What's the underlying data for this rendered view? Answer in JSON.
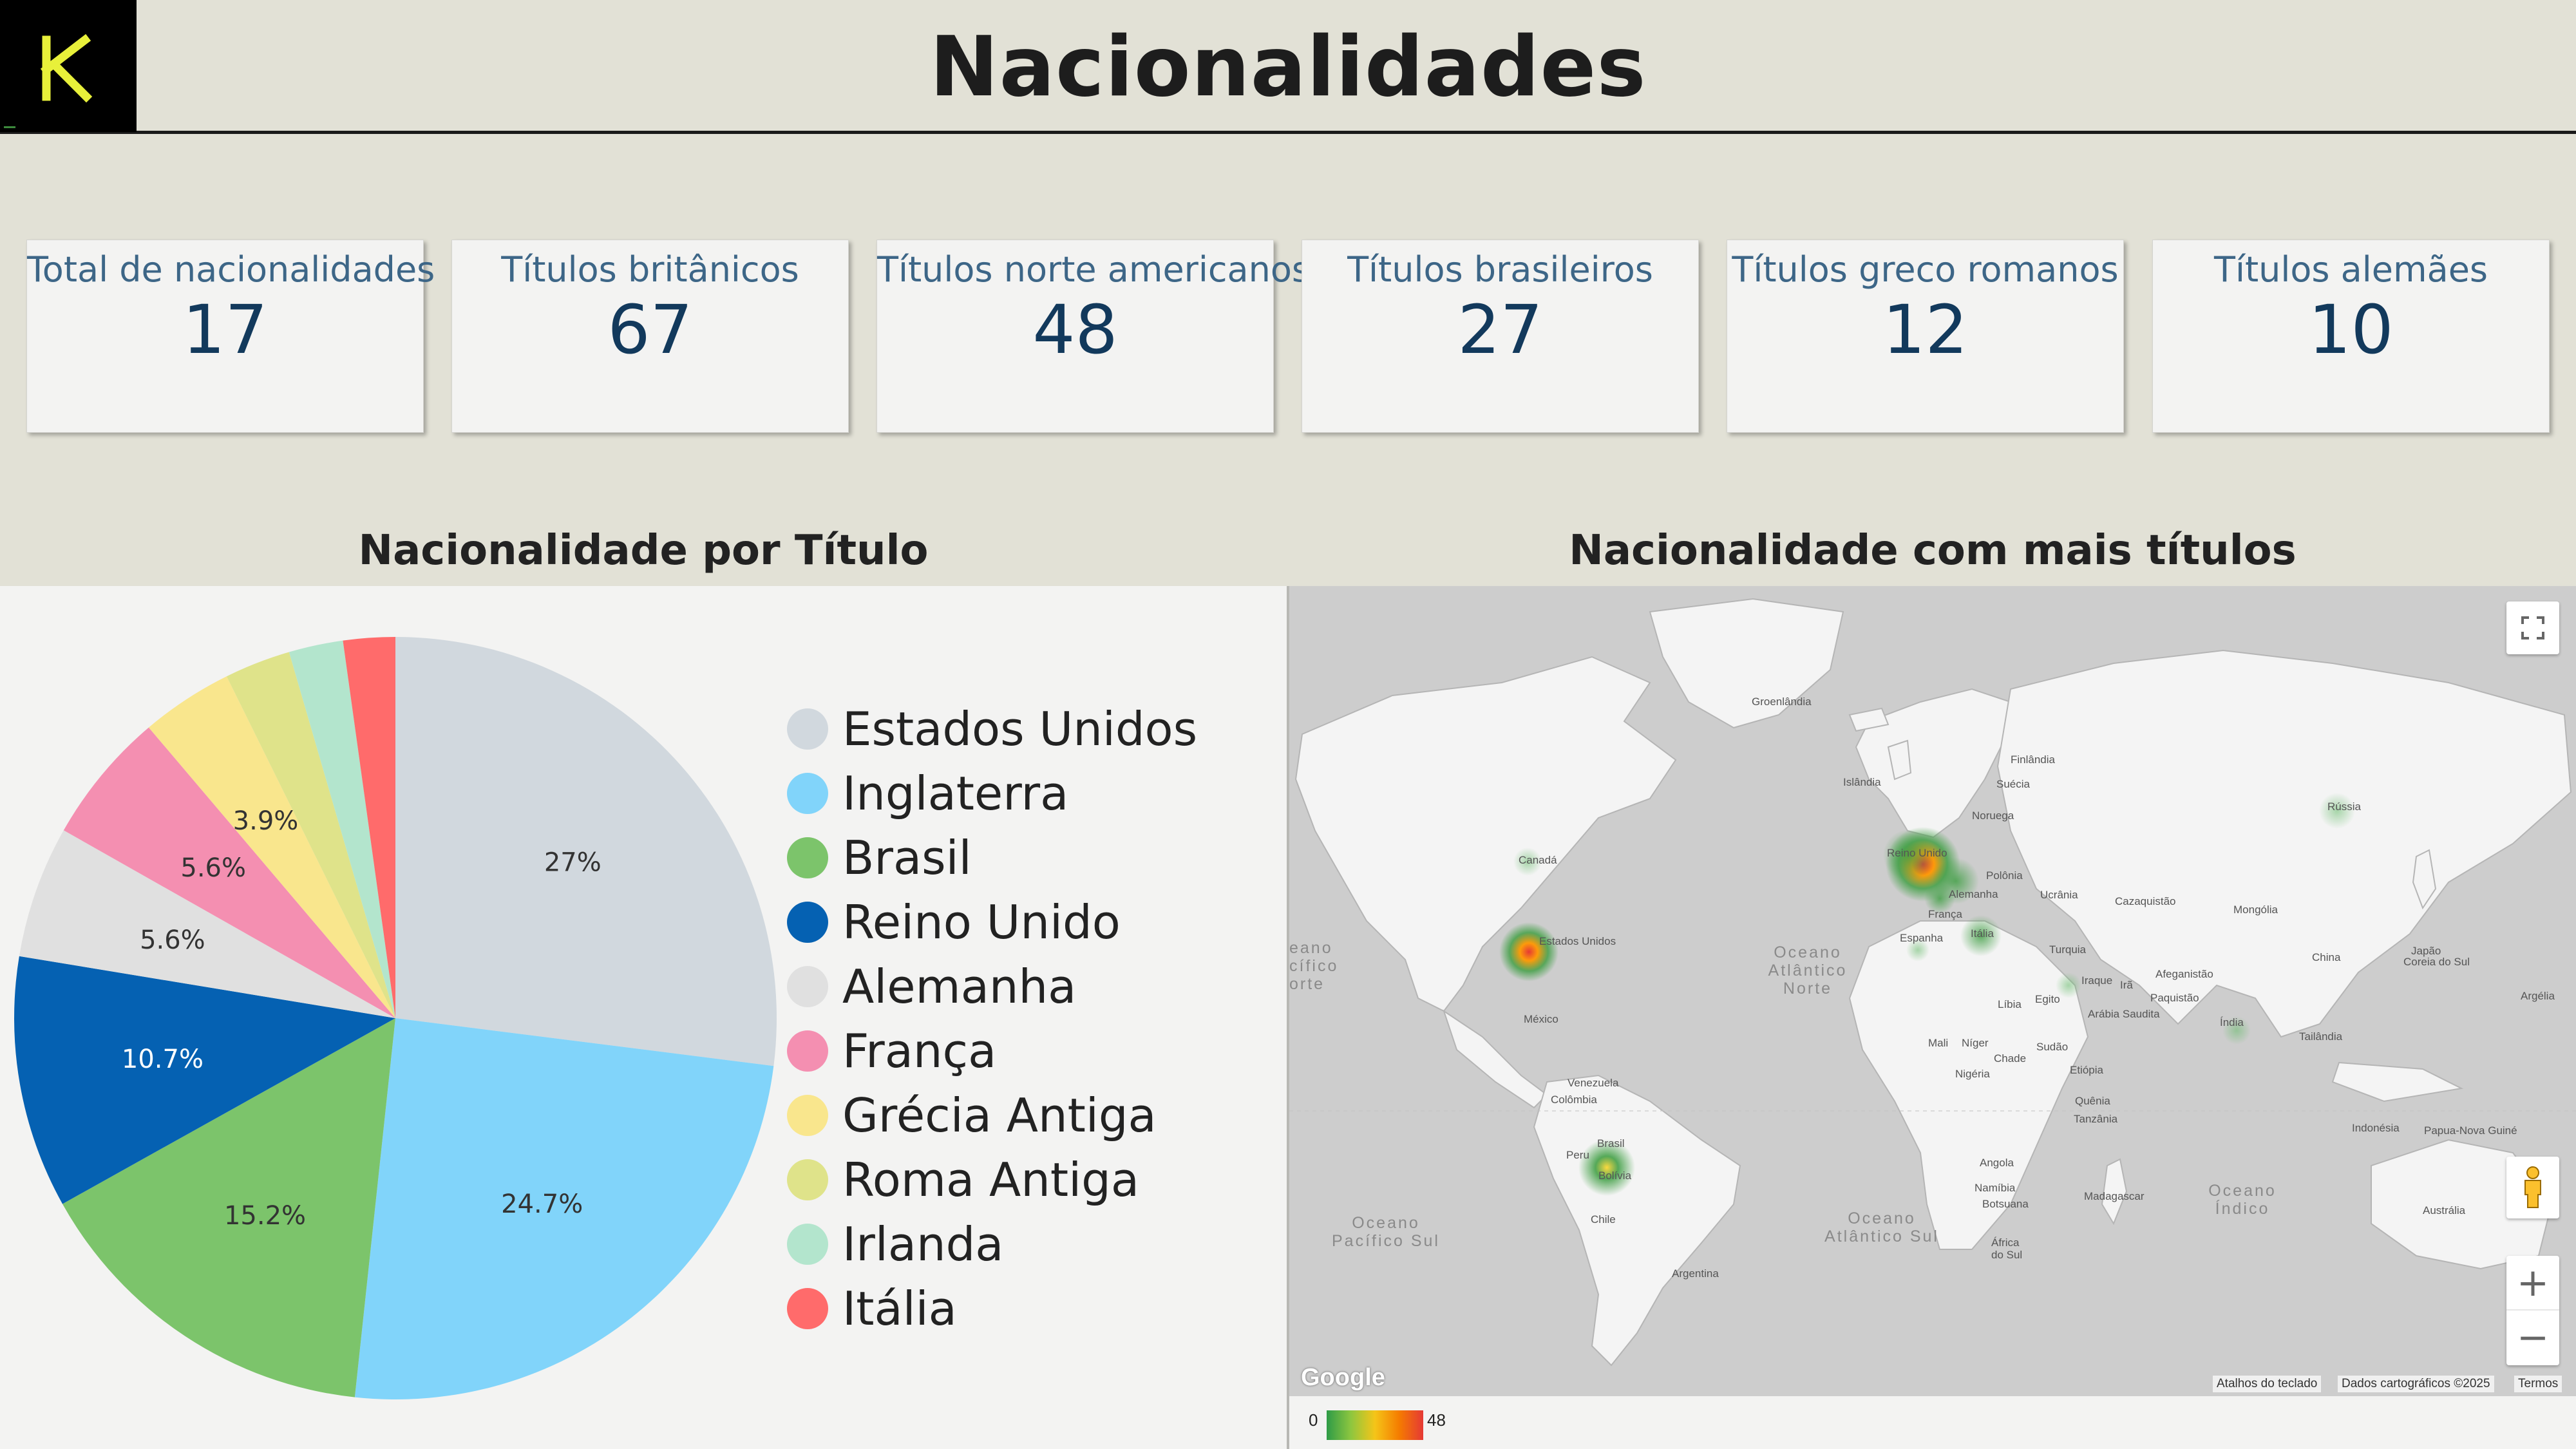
{
  "header": {
    "title": "Nacionalidades",
    "logo_letter": "K"
  },
  "kpis": [
    {
      "label": "Total de nacionalidades",
      "value": "17"
    },
    {
      "label": "Títulos britânicos",
      "value": "67"
    },
    {
      "label": "Títulos norte americanos",
      "value": "48"
    },
    {
      "label": "Títulos brasileiros",
      "value": "27"
    },
    {
      "label": "Títulos greco romanos",
      "value": "12"
    },
    {
      "label": "Títulos alemães",
      "value": "10"
    }
  ],
  "pie_section": {
    "title": "Nacionalidade por Título"
  },
  "map_section": {
    "title": "Nacionalidade com mais títulos",
    "logo": "Google",
    "attribution": {
      "keyboard": "Atalhos do teclado",
      "data": "Dados cartográficos ©2025",
      "terms": "Termos"
    },
    "scale": {
      "min": "0",
      "max": "48"
    },
    "country_labels": [
      "Groenlândia",
      "Islândia",
      "Finlândia",
      "Suécia",
      "Noruega",
      "Rússia",
      "Reino Unido",
      "Polônia",
      "Alemanha",
      "Ucrânia",
      "França",
      "Cazaquistão",
      "Mongólia",
      "Espanha",
      "Itália",
      "Turquia",
      "Canadá",
      "Estados Unidos",
      "México",
      "China",
      "Japão",
      "Coreia do Sul",
      "Afeganistão",
      "Iraque",
      "Irã",
      "Paquistão",
      "Argélia",
      "Líbia",
      "Egito",
      "Arábia Saudita",
      "Índia",
      "Tailândia",
      "Mali",
      "Níger",
      "Chade",
      "Sudão",
      "Etiópia",
      "Nigéria",
      "Venezuela",
      "Colômbia",
      "Quênia",
      "Tanzânia",
      "Indonésia",
      "Papua-Nova Guiné",
      "Peru",
      "Brasil",
      "Bolívia",
      "Angola",
      "Namíbia",
      "Botsuana",
      "Madagascar",
      "Chile",
      "África do Sul",
      "Austrália",
      "Argentina"
    ],
    "ocean_labels": [
      "Oceano Atlântico Norte",
      "Oceano Pacífico Sul",
      "Oceano Atlântico Sul",
      "Oceano Índico",
      "eano cífico orte"
    ]
  },
  "colors": {
    "Estados Unidos": "#d1d8de",
    "Inglaterra": "#81d4fa",
    "Brasil": "#7cc46b",
    "Reino Unido": "#0561b2",
    "Alemanha": "#e0e0e0",
    "França": "#f48fb1",
    "Grécia Antiga": "#f9e68d",
    "Roma Antiga": "#dfe38a",
    "Irlanda": "#b3e5cd",
    "Itália": "#ff6b6b"
  },
  "chart_data": {
    "type": "pie",
    "title": "Nacionalidade por Título",
    "legend_position": "right",
    "slices": [
      {
        "label": "Estados Unidos",
        "value": 27,
        "display": "27%"
      },
      {
        "label": "Inglaterra",
        "value": 24.7,
        "display": "24.7%"
      },
      {
        "label": "Brasil",
        "value": 15.2,
        "display": "15.2%"
      },
      {
        "label": "Reino Unido",
        "value": 10.7,
        "display": "10.7%"
      },
      {
        "label": "Alemanha",
        "value": 5.6,
        "display": "5.6%"
      },
      {
        "label": "França",
        "value": 5.6,
        "display": "5.6%"
      },
      {
        "label": "Grécia Antiga",
        "value": 3.9,
        "display": "3.9%"
      },
      {
        "label": "Roma Antiga",
        "value": 2.8,
        "display": ""
      },
      {
        "label": "Irlanda",
        "value": 2.3,
        "display": ""
      },
      {
        "label": "Itália",
        "value": 2.2,
        "display": ""
      }
    ]
  }
}
